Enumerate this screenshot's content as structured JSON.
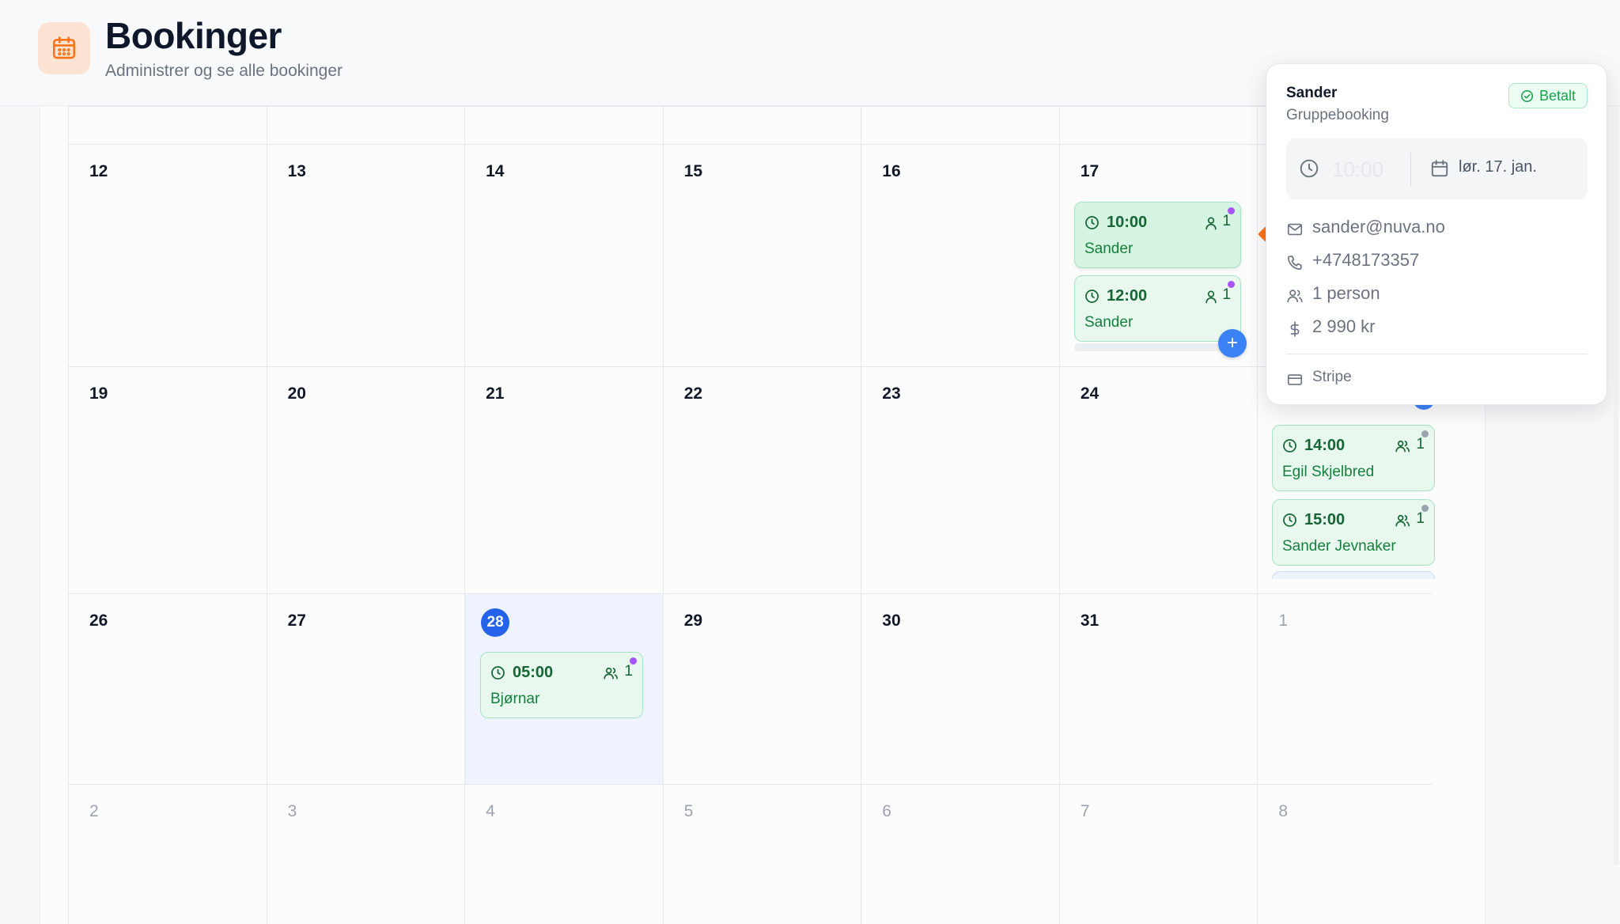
{
  "header": {
    "title": "Bookinger",
    "subtitle": "Administrer og se alle bookinger",
    "icon": "calendar-icon",
    "accent": "#f97316"
  },
  "calendar": {
    "weeks": [
      {
        "days": [
          {
            "num": ""
          },
          {
            "num": ""
          },
          {
            "num": ""
          },
          {
            "num": ""
          },
          {
            "num": ""
          },
          {
            "num": ""
          },
          {
            "num": ""
          }
        ]
      },
      {
        "days": [
          {
            "num": "12"
          },
          {
            "num": "13"
          },
          {
            "num": "14"
          },
          {
            "num": "15"
          },
          {
            "num": "16"
          },
          {
            "num": "17"
          },
          {
            "num": ""
          }
        ]
      },
      {
        "days": [
          {
            "num": "19"
          },
          {
            "num": "20"
          },
          {
            "num": "21"
          },
          {
            "num": "22"
          },
          {
            "num": "23"
          },
          {
            "num": "24"
          },
          {
            "num": ""
          }
        ]
      },
      {
        "days": [
          {
            "num": "26"
          },
          {
            "num": "27"
          },
          {
            "num": "28",
            "today": true
          },
          {
            "num": "29"
          },
          {
            "num": "30"
          },
          {
            "num": "31"
          },
          {
            "num": "1",
            "muted": true
          }
        ]
      },
      {
        "days": [
          {
            "num": "2",
            "muted": true
          },
          {
            "num": "3",
            "muted": true
          },
          {
            "num": "4",
            "muted": true
          },
          {
            "num": "5",
            "muted": true
          },
          {
            "num": "6",
            "muted": true
          },
          {
            "num": "7",
            "muted": true
          },
          {
            "num": "8",
            "muted": true
          }
        ]
      }
    ],
    "events": [
      {
        "time": "10:00",
        "name": "Sander",
        "count": "1",
        "group": false,
        "dot": "#a855f7",
        "selected": true
      },
      {
        "time": "12:00",
        "name": "Sander",
        "count": "1",
        "group": false,
        "dot": "#a855f7"
      },
      {
        "time": "14:00",
        "name": "Egil Skjelbred",
        "count": "1",
        "group": true,
        "dot": "#9ca3af"
      },
      {
        "time": "15:00",
        "name": "Sander Jevnaker",
        "count": "1",
        "group": true,
        "dot": "#9ca3af"
      },
      {
        "time": "05:00",
        "name": "Bjørnar",
        "count": "1",
        "group": true,
        "dot": "#a855f7"
      }
    ],
    "add_label": "+"
  },
  "popover": {
    "name": "Sander",
    "type": "Gruppebooking",
    "status": "Betalt",
    "time": "10:00",
    "date": "lør. 17. jan.",
    "email": "sander@nuva.no",
    "phone": "+4748173357",
    "people": "1 person",
    "price": "2 990 kr",
    "payment": "Stripe",
    "status_color": "#16a34a"
  }
}
